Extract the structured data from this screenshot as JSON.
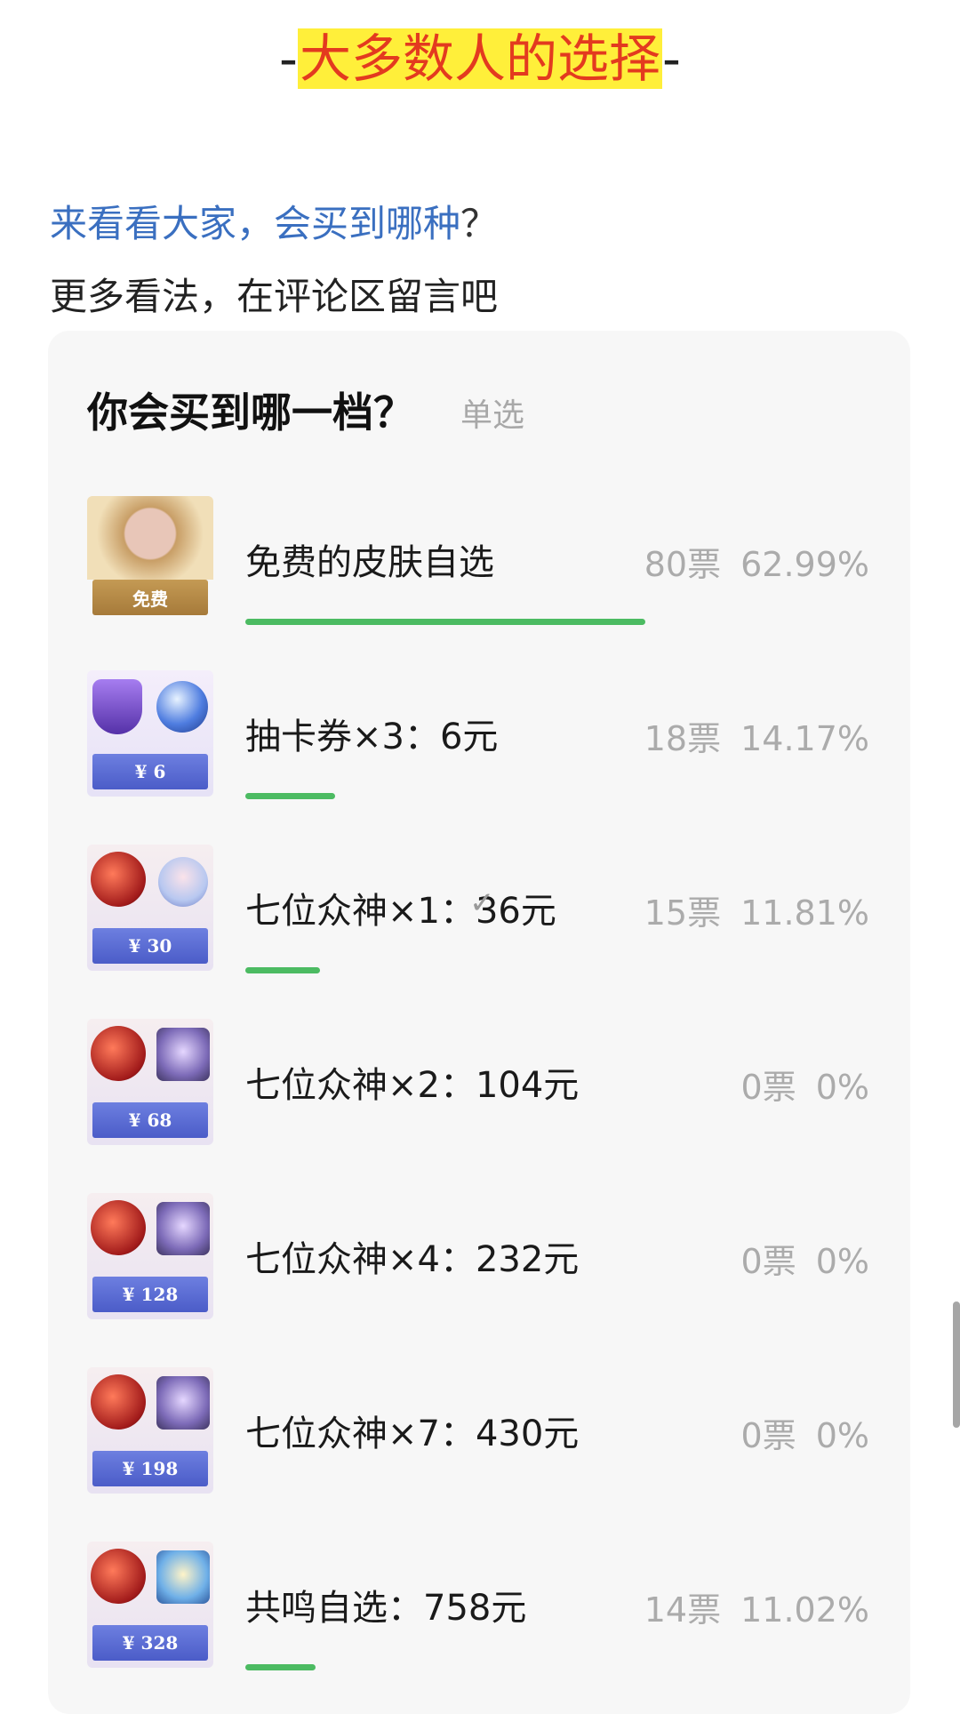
{
  "header": {
    "dash_left": "-",
    "title": "大多数人的选择",
    "dash_right": "-"
  },
  "intro": {
    "line1_link": "来看看大家，会买到哪种",
    "line1_q": "？",
    "line2": "更多看法，在评论区留言吧"
  },
  "poll": {
    "title": "你会买到哪一档？",
    "type": "单选",
    "options": [
      {
        "label": "免费的皮肤自选",
        "votes": "80票",
        "percent": "62.99%",
        "share": 0.6299,
        "thumb_price": "免费",
        "selected": false
      },
      {
        "label": "抽卡券×3：6元",
        "votes": "18票",
        "percent": "14.17%",
        "share": 0.1417,
        "thumb_price": "¥ 6",
        "selected": false
      },
      {
        "label": "七位众神×1：36元",
        "votes": "15票",
        "percent": "11.81%",
        "share": 0.1181,
        "thumb_price": "¥ 30",
        "selected": true
      },
      {
        "label": "七位众神×2：104元",
        "votes": "0票",
        "percent": "0%",
        "share": 0,
        "thumb_price": "¥ 68",
        "selected": false
      },
      {
        "label": "七位众神×4：232元",
        "votes": "0票",
        "percent": "0%",
        "share": 0,
        "thumb_price": "¥ 128",
        "selected": false
      },
      {
        "label": "七位众神×7：430元",
        "votes": "0票",
        "percent": "0%",
        "share": 0,
        "thumb_price": "¥ 198",
        "selected": false
      },
      {
        "label": "共鸣自选：758元",
        "votes": "14票",
        "percent": "11.02%",
        "share": 0.1102,
        "thumb_price": "¥ 328",
        "selected": false
      }
    ],
    "check_glyph": "✓",
    "bar_color": "#4cbb62"
  }
}
